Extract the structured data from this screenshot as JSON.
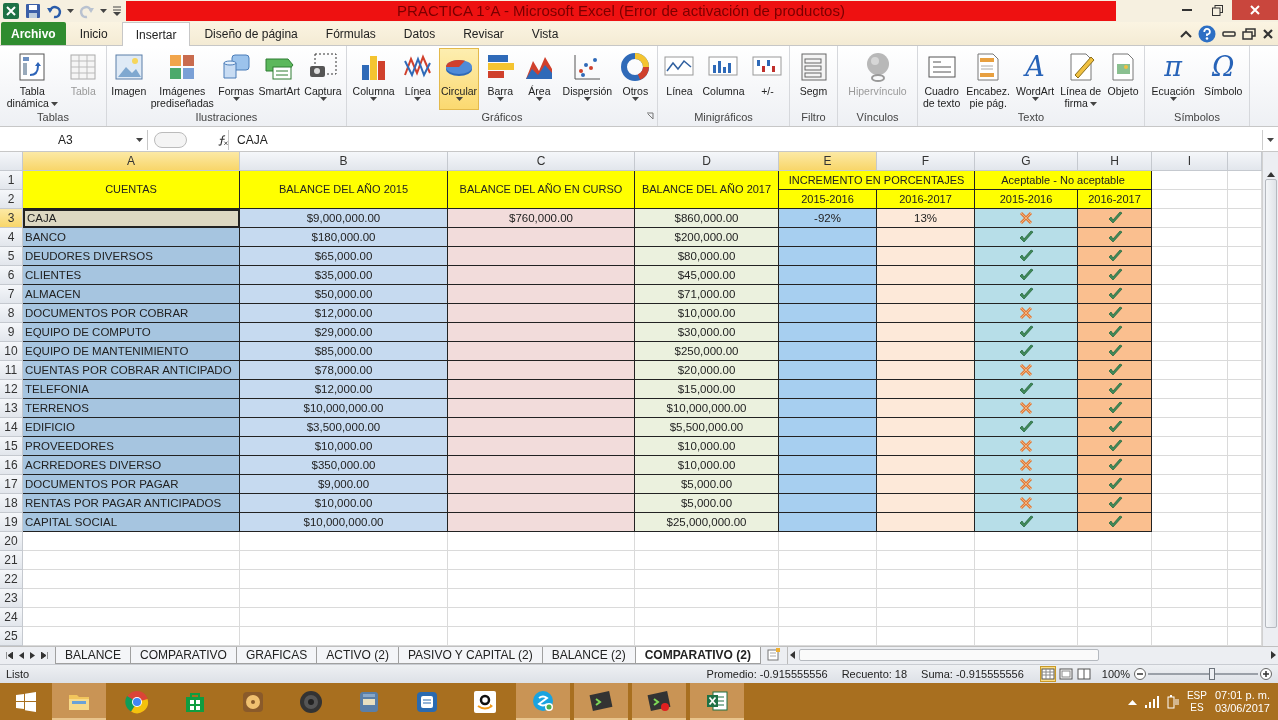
{
  "title_bar": {
    "title": "PRACTICA 1°A  -  Microsoft Excel (Error de activación de productos)",
    "redo_disabled": true
  },
  "ribbon_tabs": [
    {
      "label": "Archivo",
      "kind": "file",
      "selected": false
    },
    {
      "label": "Inicio",
      "kind": "tab",
      "selected": false
    },
    {
      "label": "Insertar",
      "kind": "tab",
      "selected": true
    },
    {
      "label": "Diseño de página",
      "kind": "tab",
      "selected": false
    },
    {
      "label": "Fórmulas",
      "kind": "tab",
      "selected": false
    },
    {
      "label": "Datos",
      "kind": "tab",
      "selected": false
    },
    {
      "label": "Revisar",
      "kind": "tab",
      "selected": false
    },
    {
      "label": "Vista",
      "kind": "tab",
      "selected": false
    }
  ],
  "ribbon_groups": [
    {
      "label": "Tablas",
      "launcher": false,
      "items": [
        {
          "lines": [
            "Tabla",
            "dinámica"
          ],
          "kind": "pivot",
          "dropdown": true,
          "disabled": false,
          "highlighted": false
        },
        {
          "lines": [
            "Tabla"
          ],
          "kind": "table",
          "dropdown": false,
          "disabled": true,
          "highlighted": false
        }
      ]
    },
    {
      "label": "Ilustraciones",
      "launcher": false,
      "items": [
        {
          "lines": [
            "Imagen"
          ],
          "kind": "image",
          "dropdown": false,
          "disabled": false,
          "highlighted": false
        },
        {
          "lines": [
            "Imágenes",
            "prediseñadas"
          ],
          "kind": "clipart",
          "dropdown": false,
          "disabled": false,
          "highlighted": false
        },
        {
          "lines": [
            "Formas"
          ],
          "kind": "shapes",
          "dropdown": true,
          "disabled": false,
          "highlighted": false
        },
        {
          "lines": [
            "SmartArt"
          ],
          "kind": "smartart",
          "dropdown": false,
          "disabled": false,
          "highlighted": false
        },
        {
          "lines": [
            "Captura"
          ],
          "kind": "screenshot",
          "dropdown": true,
          "disabled": false,
          "highlighted": false
        }
      ]
    },
    {
      "label": "Gráficos",
      "launcher": true,
      "items": [
        {
          "lines": [
            "Columna"
          ],
          "kind": "column",
          "dropdown": true,
          "disabled": false,
          "highlighted": false
        },
        {
          "lines": [
            "Línea"
          ],
          "kind": "line",
          "dropdown": true,
          "disabled": false,
          "highlighted": false
        },
        {
          "lines": [
            "Circular"
          ],
          "kind": "pie",
          "dropdown": true,
          "disabled": false,
          "highlighted": true
        },
        {
          "lines": [
            "Barra"
          ],
          "kind": "bar",
          "dropdown": true,
          "disabled": false,
          "highlighted": false
        },
        {
          "lines": [
            "Área"
          ],
          "kind": "area",
          "dropdown": true,
          "disabled": false,
          "highlighted": false
        },
        {
          "lines": [
            "Dispersión"
          ],
          "kind": "scatter",
          "dropdown": true,
          "disabled": false,
          "highlighted": false
        },
        {
          "lines": [
            "Otros"
          ],
          "kind": "donut",
          "dropdown": true,
          "disabled": false,
          "highlighted": false
        }
      ]
    },
    {
      "label": "Minigráficos",
      "launcher": false,
      "items": [
        {
          "lines": [
            "Línea"
          ],
          "kind": "spark-line",
          "dropdown": false,
          "disabled": false,
          "highlighted": false
        },
        {
          "lines": [
            "Columna"
          ],
          "kind": "spark-column",
          "dropdown": false,
          "disabled": false,
          "highlighted": false
        },
        {
          "lines": [
            "+/-"
          ],
          "kind": "spark-winloss",
          "dropdown": false,
          "disabled": false,
          "highlighted": false
        }
      ]
    },
    {
      "label": "Filtro",
      "launcher": false,
      "items": [
        {
          "lines": [
            "Segm"
          ],
          "kind": "slicer",
          "dropdown": false,
          "disabled": false,
          "highlighted": false
        }
      ]
    },
    {
      "label": "Vínculos",
      "launcher": false,
      "items": [
        {
          "lines": [
            "Hipervínculo"
          ],
          "kind": "globe",
          "dropdown": false,
          "disabled": true,
          "highlighted": false
        }
      ]
    },
    {
      "label": "Texto",
      "launcher": false,
      "items": [
        {
          "lines": [
            "Cuadro",
            "de texto"
          ],
          "kind": "textbox",
          "dropdown": false,
          "disabled": false,
          "highlighted": false
        },
        {
          "lines": [
            "Encabez.",
            "pie pág."
          ],
          "kind": "header",
          "dropdown": false,
          "disabled": false,
          "highlighted": false
        },
        {
          "lines": [
            "WordArt"
          ],
          "kind": "symbol",
          "glyph": "A",
          "dropdown": true,
          "disabled": false,
          "highlighted": false
        },
        {
          "lines": [
            "Línea de",
            "firma"
          ],
          "kind": "signature",
          "dropdown": true,
          "disabled": false,
          "highlighted": false
        },
        {
          "lines": [
            "Objeto"
          ],
          "kind": "object",
          "dropdown": false,
          "disabled": false,
          "highlighted": false
        }
      ]
    },
    {
      "label": "Símbolos",
      "launcher": false,
      "items": [
        {
          "lines": [
            "Ecuación"
          ],
          "kind": "symbol",
          "glyph": "π",
          "dropdown": true,
          "disabled": false,
          "highlighted": false
        },
        {
          "lines": [
            "Símbolo"
          ],
          "kind": "symbol",
          "glyph": "Ω",
          "dropdown": false,
          "disabled": false,
          "highlighted": false
        }
      ]
    }
  ],
  "name_box": {
    "value": "A3"
  },
  "formula_bar": {
    "value": "CAJA"
  },
  "sheet": {
    "columns": [
      {
        "label": "A",
        "selected": true
      },
      {
        "label": "B",
        "selected": false
      },
      {
        "label": "C",
        "selected": false
      },
      {
        "label": "D",
        "selected": false
      },
      {
        "label": "E",
        "selected": true
      },
      {
        "label": "F",
        "selected": false
      },
      {
        "label": "G",
        "selected": false
      },
      {
        "label": "H",
        "selected": false
      },
      {
        "label": "I",
        "selected": false
      }
    ],
    "row_headers": [
      {
        "label": "1",
        "selected": false
      },
      {
        "label": "2",
        "selected": false
      },
      {
        "label": "3",
        "selected": true
      },
      {
        "label": "4",
        "selected": false
      },
      {
        "label": "5",
        "selected": false
      },
      {
        "label": "6",
        "selected": false
      },
      {
        "label": "7",
        "selected": false
      },
      {
        "label": "8",
        "selected": false
      },
      {
        "label": "9",
        "selected": false
      },
      {
        "label": "10",
        "selected": false
      },
      {
        "label": "11",
        "selected": false
      },
      {
        "label": "12",
        "selected": false
      },
      {
        "label": "13",
        "selected": false
      },
      {
        "label": "14",
        "selected": false
      },
      {
        "label": "15",
        "selected": false
      },
      {
        "label": "16",
        "selected": false
      },
      {
        "label": "17",
        "selected": false
      },
      {
        "label": "18",
        "selected": false
      },
      {
        "label": "19",
        "selected": false
      },
      {
        "label": "20",
        "selected": false
      },
      {
        "label": "21",
        "selected": false
      },
      {
        "label": "22",
        "selected": false
      },
      {
        "label": "23",
        "selected": false
      },
      {
        "label": "24",
        "selected": false
      },
      {
        "label": "25",
        "selected": false
      }
    ],
    "headers": [
      "CUENTAS",
      "BALANCE DEL AÑO 2015",
      "BALANCE DEL AÑO EN CURSO",
      "BALANCE DEL AÑO 2017"
    ],
    "group_headers": [
      {
        "label": "INCREMENTO EN PORCENTAJES",
        "subheaders": [
          "2015-2016",
          "2016-2017"
        ]
      },
      {
        "label": "Aceptable - No aceptable",
        "subheaders": [
          "2015-2016",
          "2016-2017"
        ]
      }
    ],
    "rows": [
      {
        "cuenta": "CAJA",
        "balance_2015": "$9,000,000.00",
        "balance_en_curso": "$760,000.00",
        "balance_2017": "$860,000.00",
        "incremento_2015_2016": "-92%",
        "incremento_2016_2017": "13%",
        "aceptable_2015_2016": false,
        "aceptable_2016_2017": true,
        "selected": true
      },
      {
        "cuenta": "BANCO",
        "balance_2015": "$180,000.00",
        "balance_2017": "$200,000.00",
        "aceptable_2015_2016": true,
        "aceptable_2016_2017": true,
        "selected": false
      },
      {
        "cuenta": "DEUDORES DIVERSOS",
        "balance_2015": "$65,000.00",
        "balance_2017": "$80,000.00",
        "aceptable_2015_2016": true,
        "aceptable_2016_2017": true,
        "selected": false
      },
      {
        "cuenta": "CLIENTES",
        "balance_2015": "$35,000.00",
        "balance_2017": "$45,000.00",
        "aceptable_2015_2016": true,
        "aceptable_2016_2017": true,
        "selected": false
      },
      {
        "cuenta": "ALMACEN",
        "balance_2015": "$50,000.00",
        "balance_2017": "$71,000.00",
        "aceptable_2015_2016": true,
        "aceptable_2016_2017": true,
        "selected": false
      },
      {
        "cuenta": "DOCUMENTOS POR COBRAR",
        "balance_2015": "$12,000.00",
        "balance_2017": "$10,000.00",
        "aceptable_2015_2016": false,
        "aceptable_2016_2017": true,
        "selected": false
      },
      {
        "cuenta": "EQUIPO DE COMPUTO",
        "balance_2015": "$29,000.00",
        "balance_2017": "$30,000.00",
        "aceptable_2015_2016": true,
        "aceptable_2016_2017": true,
        "selected": false
      },
      {
        "cuenta": "EQUIPO DE MANTENIMIENTO",
        "balance_2015": "$85,000.00",
        "balance_2017": "$250,000.00",
        "aceptable_2015_2016": true,
        "aceptable_2016_2017": true,
        "selected": false
      },
      {
        "cuenta": "CUENTAS POR COBRAR ANTICIPADO",
        "balance_2015": "$78,000.00",
        "balance_2017": "$20,000.00",
        "aceptable_2015_2016": false,
        "aceptable_2016_2017": true,
        "selected": false
      },
      {
        "cuenta": "TELEFONIA",
        "balance_2015": "$12,000.00",
        "balance_2017": "$15,000.00",
        "aceptable_2015_2016": true,
        "aceptable_2016_2017": true,
        "selected": false
      },
      {
        "cuenta": "TERRENOS",
        "balance_2015": "$10,000,000.00",
        "balance_2017": "$10,000,000.00",
        "aceptable_2015_2016": false,
        "aceptable_2016_2017": true,
        "selected": false
      },
      {
        "cuenta": "EDIFICIO",
        "balance_2015": "$3,500,000.00",
        "balance_2017": "$5,500,000.00",
        "aceptable_2015_2016": true,
        "aceptable_2016_2017": true,
        "selected": false
      },
      {
        "cuenta": "PROVEEDORES",
        "balance_2015": "$10,000.00",
        "balance_2017": "$10,000.00",
        "aceptable_2015_2016": false,
        "aceptable_2016_2017": true,
        "selected": false
      },
      {
        "cuenta": "ACRREDORES DIVERSO",
        "balance_2015": "$350,000.00",
        "balance_2017": "$10,000.00",
        "aceptable_2015_2016": false,
        "aceptable_2016_2017": true,
        "selected": false
      },
      {
        "cuenta": "DOCUMENTOS POR PAGAR",
        "balance_2015": "$9,000.00",
        "balance_2017": "$5,000.00",
        "aceptable_2015_2016": false,
        "aceptable_2016_2017": true,
        "selected": false
      },
      {
        "cuenta": "RENTAS POR PAGAR ANTICIPADOS",
        "balance_2015": "$10,000.00",
        "balance_2017": "$5,000.00",
        "aceptable_2015_2016": false,
        "aceptable_2016_2017": true,
        "selected": false
      },
      {
        "cuenta": "CAPITAL SOCIAL",
        "balance_2015": "$10,000,000.00",
        "balance_2017": "$25,000,000.00",
        "aceptable_2015_2016": true,
        "aceptable_2016_2017": true,
        "selected": false
      }
    ]
  },
  "sheet_tabs": [
    {
      "label": "BALANCE",
      "selected": false
    },
    {
      "label": "COMPARATIVO",
      "selected": false
    },
    {
      "label": "GRAFICAS",
      "selected": false
    },
    {
      "label": "ACTIVO (2)",
      "selected": false
    },
    {
      "label": "PASIVO Y CAPITAL (2)",
      "selected": false
    },
    {
      "label": "BALANCE (2)",
      "selected": false
    },
    {
      "label": "COMPARATIVO (2)",
      "selected": true
    }
  ],
  "status_bar": {
    "mode": "Listo",
    "average": "Promedio: -0.915555556",
    "count": "Recuento: 18",
    "sum": "Suma: -0.915555556",
    "views": [
      {
        "kind": "normal",
        "selected": true
      },
      {
        "kind": "layout",
        "selected": false
      },
      {
        "kind": "pagebreak",
        "selected": false
      }
    ],
    "zoom": "100%",
    "level": 0.58
  },
  "taskbar": {
    "apps": [
      {
        "kind": "folder",
        "running": true
      },
      {
        "kind": "browser",
        "running": false
      },
      {
        "kind": "store",
        "running": false
      },
      {
        "kind": "media",
        "running": false
      },
      {
        "kind": "speaker",
        "running": false
      },
      {
        "kind": "doc",
        "running": false
      },
      {
        "kind": "gear",
        "running": false
      },
      {
        "kind": "amazon",
        "running": false
      },
      {
        "kind": "chat",
        "running": true
      },
      {
        "kind": "terminal",
        "running": true
      },
      {
        "kind": "terminal-rec",
        "running": true
      },
      {
        "kind": "sheet",
        "running": true
      }
    ],
    "language": "ESP",
    "layout": "ES",
    "time": "07:01 p. m.",
    "date": "03/06/2017"
  }
}
